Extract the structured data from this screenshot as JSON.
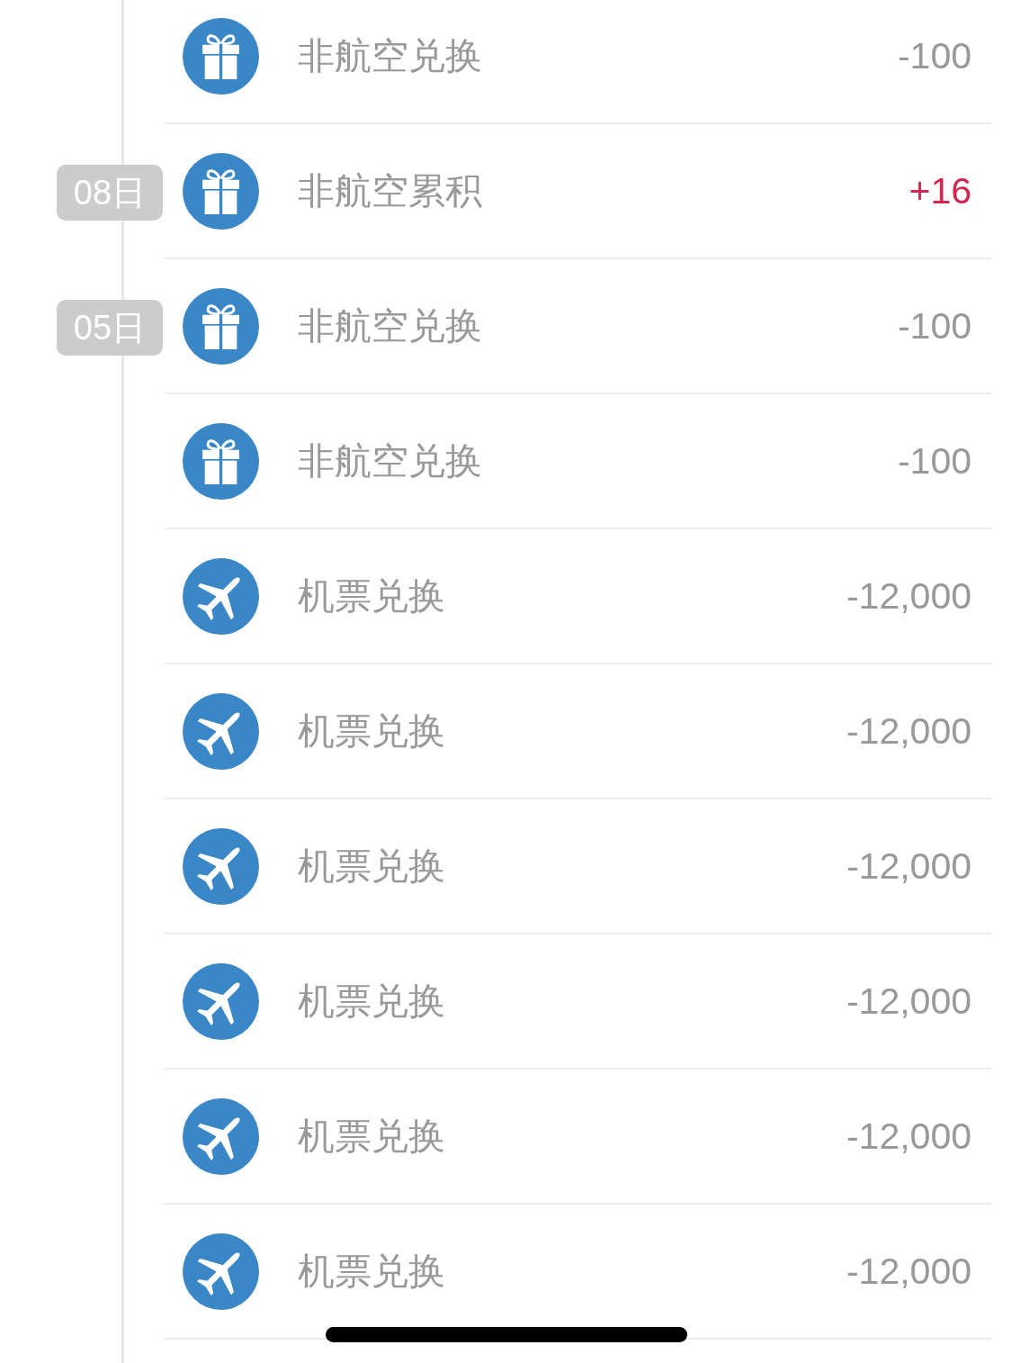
{
  "records": [
    {
      "kind": "gift",
      "title": "非航空兑换",
      "amount": "-100",
      "credit": false
    },
    {
      "date": "08日",
      "kind": "gift",
      "title": "非航空累积",
      "amount": "+16",
      "credit": true
    },
    {
      "date": "05日",
      "kind": "gift",
      "title": "非航空兑换",
      "amount": "-100",
      "credit": false
    },
    {
      "kind": "gift",
      "title": "非航空兑换",
      "amount": "-100",
      "credit": false
    },
    {
      "kind": "plane",
      "title": "机票兑换",
      "amount": "-12,000",
      "credit": false
    },
    {
      "kind": "plane",
      "title": "机票兑换",
      "amount": "-12,000",
      "credit": false
    },
    {
      "kind": "plane",
      "title": "机票兑换",
      "amount": "-12,000",
      "credit": false
    },
    {
      "kind": "plane",
      "title": "机票兑换",
      "amount": "-12,000",
      "credit": false
    },
    {
      "kind": "plane",
      "title": "机票兑换",
      "amount": "-12,000",
      "credit": false
    },
    {
      "kind": "plane",
      "title": "机票兑换",
      "amount": "-12,000",
      "credit": false
    }
  ]
}
